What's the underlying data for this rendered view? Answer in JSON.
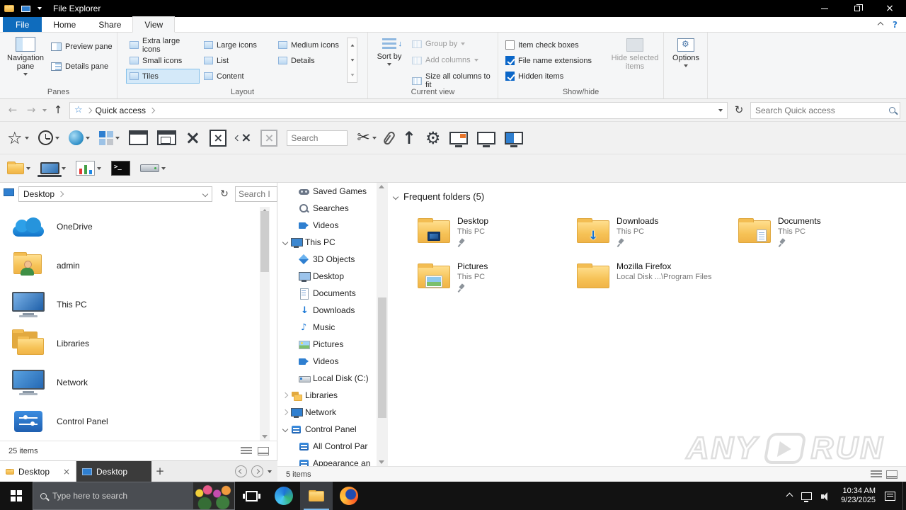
{
  "titlebar": {
    "title": "File Explorer"
  },
  "tabs": {
    "file": "File",
    "home": "Home",
    "share": "Share",
    "view": "View"
  },
  "ribbon": {
    "panes": {
      "label": "Panes",
      "navigation": "Navigation pane",
      "preview": "Preview pane",
      "details": "Details pane"
    },
    "layout": {
      "label": "Layout",
      "items": [
        "Extra large icons",
        "Large icons",
        "Medium icons",
        "Small icons",
        "List",
        "Details",
        "Tiles",
        "Content"
      ]
    },
    "current_view": {
      "label": "Current view",
      "sort_by": "Sort by",
      "group_by": "Group by",
      "add_columns": "Add columns",
      "size_columns": "Size all columns to fit"
    },
    "show_hide": {
      "label": "Show/hide",
      "item_check_boxes": "Item check boxes",
      "file_name_extensions": "File name extensions",
      "hidden_items": "Hidden items",
      "hide_selected": "Hide selected items"
    },
    "options": {
      "label": "Options"
    }
  },
  "address": {
    "location": "Quick access",
    "search_placeholder": "Search Quick access"
  },
  "toolbar": {
    "search_placeholder": "Search"
  },
  "left_panel": {
    "location": "Desktop",
    "search_placeholder": "Search I",
    "items": [
      "OneDrive",
      "admin",
      "This PC",
      "Libraries",
      "Network",
      "Control Panel"
    ],
    "status": "25 items",
    "tabs": [
      "Desktop",
      "Desktop"
    ]
  },
  "tree": {
    "items": [
      "Saved Games",
      "Searches",
      "Videos",
      "This PC",
      "3D Objects",
      "Desktop",
      "Documents",
      "Downloads",
      "Music",
      "Pictures",
      "Videos",
      "Local Disk (C:)",
      "Libraries",
      "Network",
      "Control Panel",
      "All Control Par",
      "Appearance an"
    ]
  },
  "content": {
    "section_title": "Frequent folders (5)",
    "folders": [
      {
        "name": "Desktop",
        "location": "This PC"
      },
      {
        "name": "Downloads",
        "location": "This PC"
      },
      {
        "name": "Documents",
        "location": "This PC"
      },
      {
        "name": "Pictures",
        "location": "This PC"
      },
      {
        "name": "Mozilla Firefox",
        "location": "Local Disk ...\\Program Files"
      }
    ],
    "status": "5 items"
  },
  "watermark": {
    "left": "ANY",
    "right": "RUN"
  },
  "taskbar": {
    "search_placeholder": "Type here to search",
    "time": "10:34 AM",
    "date": "9/23/2025"
  }
}
